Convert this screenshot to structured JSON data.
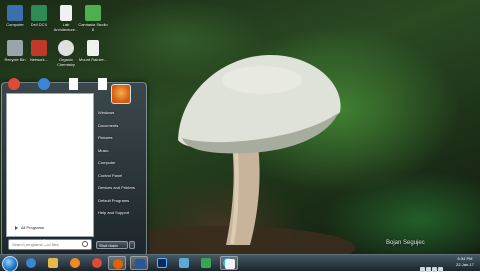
{
  "desktop": {
    "icons": [
      {
        "label": "Computer",
        "icon": "computer-icon",
        "color": "#3a6fb0"
      },
      {
        "label": "Dell DCX",
        "icon": "program-icon",
        "color": "#2e8b57"
      },
      {
        "label": "Lab Architecture...",
        "icon": "document-icon",
        "color": "#f0f0f0"
      },
      {
        "label": "Camtasia Studio 8",
        "icon": "camtasia-icon",
        "color": "#4caf50"
      },
      {
        "label": "Recycle Bin",
        "icon": "recycle-bin-icon",
        "color": "#9aa4ad"
      },
      {
        "label": "Network...",
        "icon": "program-icon",
        "color": "#c0392b"
      },
      {
        "label": "Organic Chemistry",
        "icon": "chrome-icon",
        "color": "#e0e0e0"
      },
      {
        "label": "Mount Rainier...",
        "icon": "document-icon",
        "color": "#f0f0f0"
      }
    ],
    "watermark": "Bojan Segujec"
  },
  "start_menu": {
    "pinned_top": [
      {
        "icon": "chrome-icon",
        "color": "#dd4b39"
      },
      {
        "icon": "ie-icon",
        "color": "#3a86d4"
      },
      {
        "icon": "document-icon",
        "color": "#ffffff"
      },
      {
        "icon": "document-icon",
        "color": "#ffffff"
      }
    ],
    "all_programs": "All Programs",
    "search_placeholder": "Search programs and files",
    "right_items": [
      "Windows",
      "Documents",
      "Pictures",
      "Music",
      "Computer",
      "Control Panel",
      "Devices and Printers",
      "Default Programs",
      "Help and Support"
    ],
    "shutdown_label": "Shut down"
  },
  "taskbar": {
    "items": [
      {
        "icon": "ie-icon",
        "color": "#3a86d4",
        "active": false
      },
      {
        "icon": "folder-icon",
        "color": "#e8b84a",
        "active": false
      },
      {
        "icon": "media-player-icon",
        "color": "#f08a24",
        "active": false
      },
      {
        "icon": "chrome-icon",
        "color": "#dd4b39",
        "active": false
      },
      {
        "icon": "firefox-icon",
        "color": "#e66000",
        "active": true
      },
      {
        "icon": "word-icon",
        "color": "#2b5797",
        "active": true
      },
      {
        "icon": "photoshop-icon",
        "color": "#0a2b5a",
        "active": false
      },
      {
        "icon": "explorer-icon",
        "color": "#5aa8d8",
        "active": false
      },
      {
        "icon": "dell-icon",
        "color": "#3aa655",
        "active": false
      },
      {
        "icon": "skype-icon",
        "color": "#00aff0",
        "active": false
      },
      {
        "icon": "camtasia-icon",
        "color": "#f4f4f4",
        "active": true
      }
    ],
    "clock_time": "6:34 PM",
    "clock_date": "22-Jan-17"
  }
}
